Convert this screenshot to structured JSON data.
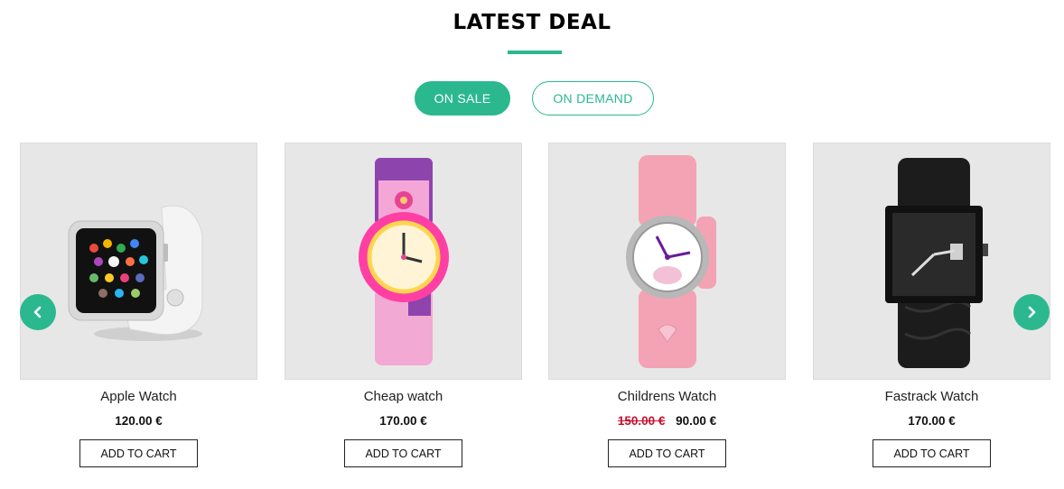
{
  "section": {
    "title": "LATEST DEAL",
    "accent_color": "#2bb88f"
  },
  "tabs": [
    {
      "label": "ON SALE",
      "active": true
    },
    {
      "label": "ON DEMAND",
      "active": false
    }
  ],
  "carousel": {
    "prev_icon": "chevron-left-icon",
    "next_icon": "chevron-right-icon"
  },
  "products": [
    {
      "name": "Apple Watch",
      "price": "120.00 €",
      "old_price": "",
      "cart_label": "ADD TO CART",
      "image": "apple-watch-image"
    },
    {
      "name": "Cheap watch",
      "price": "170.00 €",
      "old_price": "",
      "cart_label": "ADD TO CART",
      "image": "kids-flower-watch-image"
    },
    {
      "name": "Childrens Watch",
      "price": "90.00 €",
      "old_price": "150.00 €",
      "cart_label": "ADD TO CART",
      "image": "pink-strap-watch-image"
    },
    {
      "name": "Fastrack Watch",
      "price": "170.00 €",
      "old_price": "",
      "cart_label": "ADD TO CART",
      "image": "black-square-watch-image"
    }
  ]
}
